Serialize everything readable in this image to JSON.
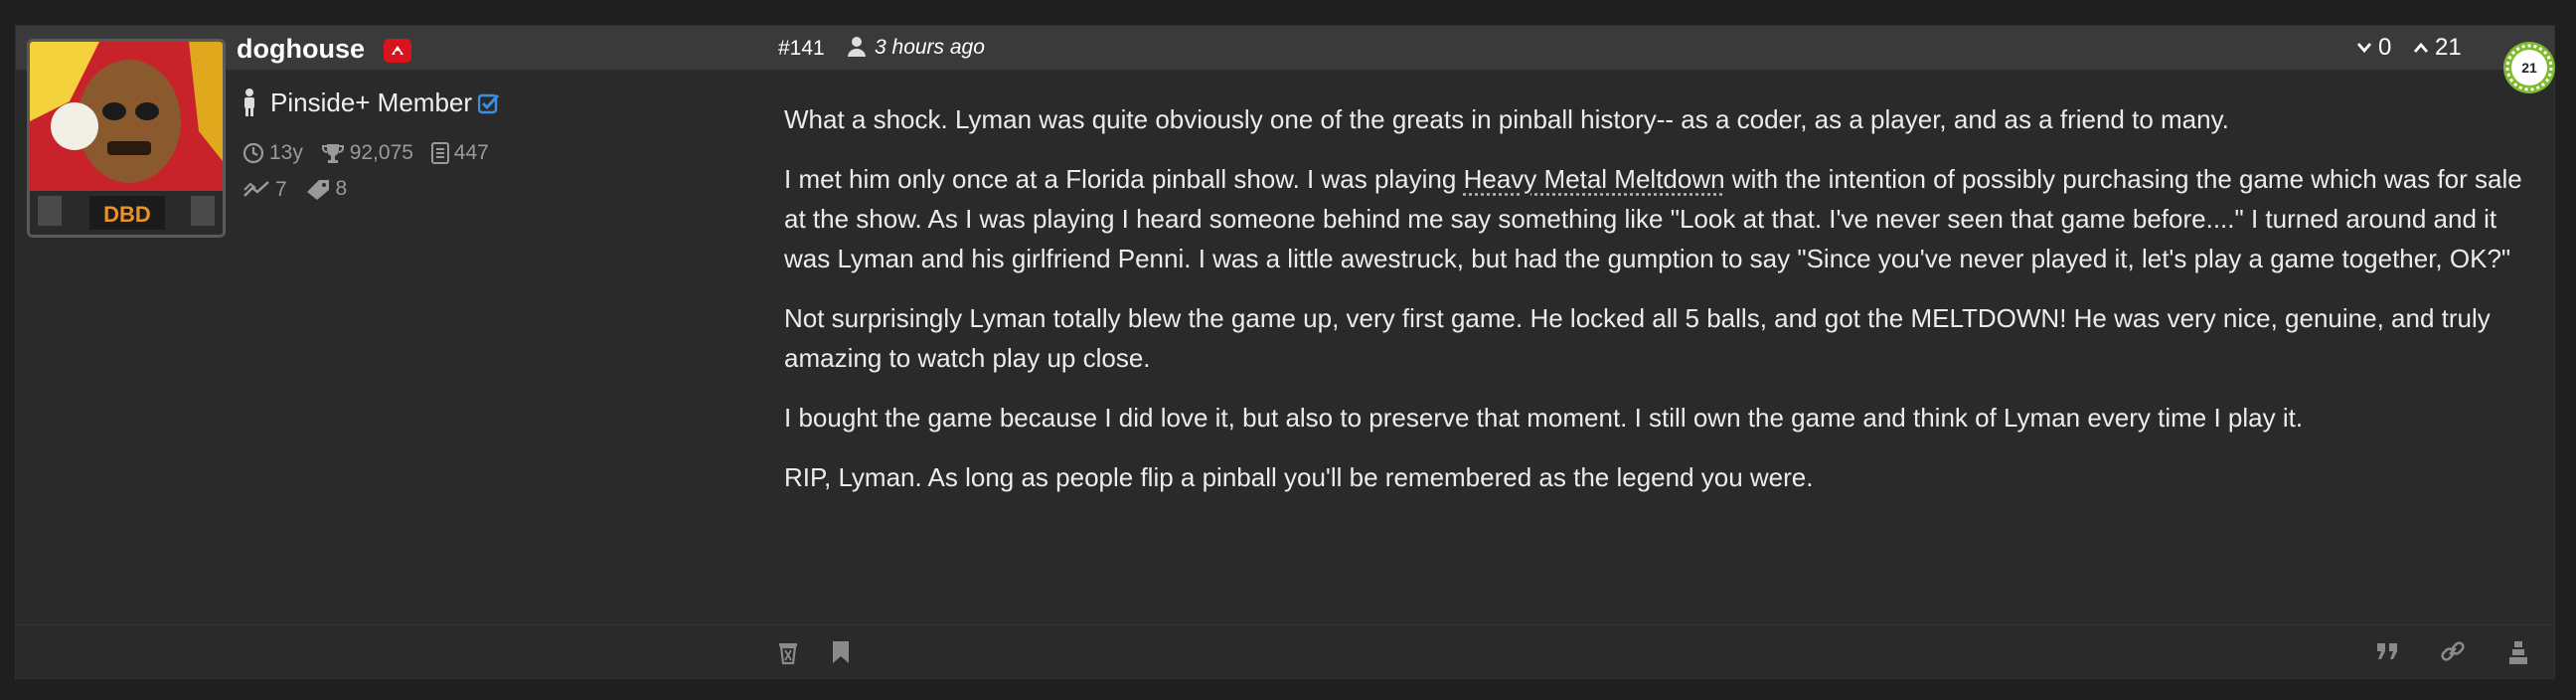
{
  "author": {
    "username": "doghouse",
    "avatar_text": "DBD",
    "role": "Pinside+ Member",
    "stats": {
      "age": "13y",
      "score": "92,075",
      "posts": "447",
      "trades": "7",
      "tags": "8"
    }
  },
  "post": {
    "number": "#141",
    "time": "3 hours ago",
    "downvotes": "0",
    "upvotes": "21",
    "score_badge": "21",
    "paragraphs": {
      "p1": "What a shock. Lyman was quite obviously one of the greats in pinball history-- as a coder, as a player, and as a friend to many.",
      "p2_before": "I met him only once at a Florida pinball show. I was playing ",
      "p2_link": "Heavy Metal Meltdown",
      "p2_after": " with the intention of possibly purchasing the game which was for sale at the show. As I was playing I heard someone behind me say something like \"Look at that. I've never seen that game before....\" I turned around and it was Lyman and his girlfriend Penni. I was a little awestruck, but had the gumption to say \"Since you've never played it, let's play a game together, OK?\"",
      "p3": "Not surprisingly Lyman totally blew the game up, very first game. He locked all 5 balls, and got the MELTDOWN! He was very nice, genuine, and truly amazing to watch play up close.",
      "p4": "I bought the game because I did love it, but also to preserve that moment. I still own the game and think of Lyman every time I play it.",
      "p5": "RIP, Lyman. As long as people flip a pinball you'll be remembered as the legend you were."
    }
  },
  "icons": {
    "footer_left": [
      "trash-icon",
      "bookmark-icon"
    ],
    "footer_right": [
      "quote-icon",
      "link-icon",
      "moderator-icon"
    ]
  },
  "colors": {
    "accent_badge": "#d9141d",
    "check": "#3d8fe0",
    "score_ring": "#7dbb2c"
  }
}
